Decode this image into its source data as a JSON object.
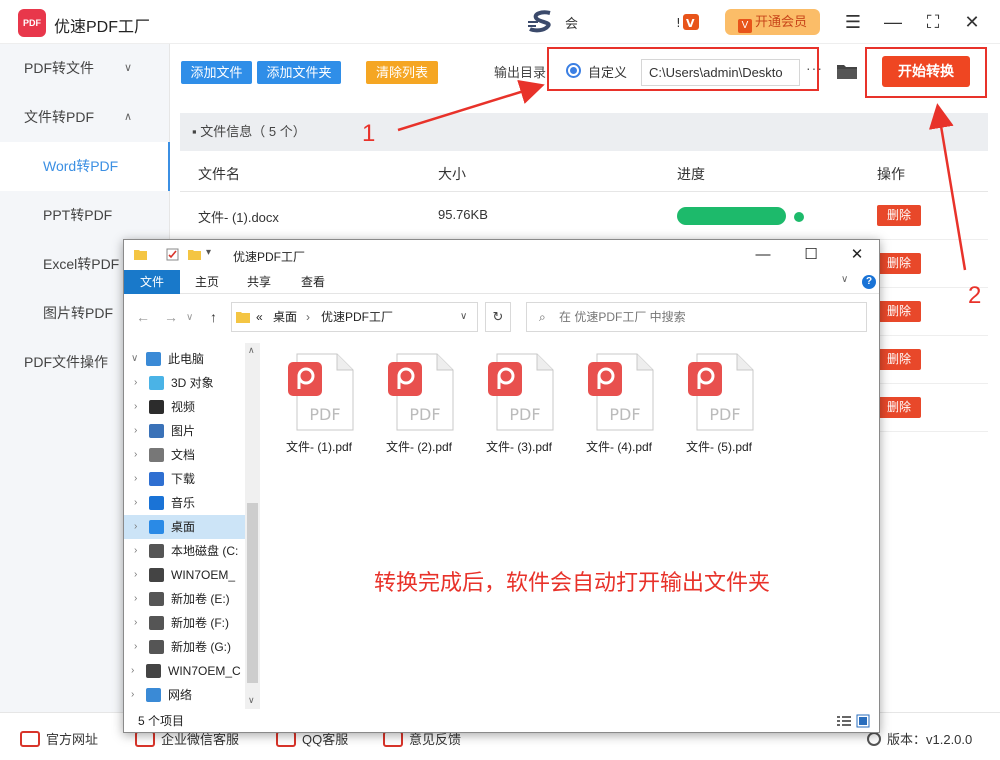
{
  "app": {
    "title": "优速PDF工厂",
    "logo_text": "PDF",
    "s_text": "会",
    "vip_label": "开通会员",
    "vip_icon": "V"
  },
  "sidebar": {
    "items": [
      {
        "label": "PDF转文件",
        "type": "group",
        "chevron": "∨"
      },
      {
        "label": "文件转PDF",
        "type": "group",
        "chevron": "∧"
      },
      {
        "label": "Word转PDF",
        "type": "sub",
        "active": true
      },
      {
        "label": "PPT转PDF",
        "type": "sub"
      },
      {
        "label": "Excel转PDF",
        "type": "sub"
      },
      {
        "label": "图片转PDF",
        "type": "sub"
      },
      {
        "label": "PDF文件操作",
        "type": "group"
      }
    ]
  },
  "toolbar": {
    "add_file": "添加文件",
    "add_folder": "添加文件夹",
    "clear_list": "清除列表",
    "output_dir_label": "输出目录:",
    "custom_label": "自定义",
    "path_value": "C:\\Users\\admin\\Deskto",
    "more": "···",
    "start": "开始转换"
  },
  "file_info": {
    "label": "文件信息（ 5 个）"
  },
  "table": {
    "headers": [
      "文件名",
      "大小",
      "进度",
      "操作"
    ],
    "rows": [
      {
        "name": "文件- (1).docx",
        "size": "95.76KB",
        "progress": 1.0,
        "action": "删除"
      },
      {
        "name": "",
        "size": "",
        "action": "删除"
      },
      {
        "name": "",
        "size": "",
        "action": "删除"
      },
      {
        "name": "",
        "size": "",
        "action": "删除"
      },
      {
        "name": "",
        "size": "",
        "action": "删除"
      }
    ]
  },
  "statusbar": {
    "links": [
      "官方网址",
      "企业微信客服",
      "QQ客服",
      "意见反馈"
    ],
    "version": "版本：v1.2.0.0"
  },
  "annotations": {
    "num1": "1",
    "num2": "2",
    "message": "转换完成后，软件会自动打开输出文件夹"
  },
  "explorer": {
    "title": "优速PDF工厂",
    "ribbon_tabs": [
      "文件",
      "主页",
      "共享",
      "查看"
    ],
    "address": [
      "«",
      "桌面",
      "›",
      "优速PDF工厂"
    ],
    "search_placeholder": "在 优速PDF工厂 中搜索",
    "tree": [
      {
        "label": "此电脑",
        "expanded": true,
        "indent": 0
      },
      {
        "label": "3D 对象",
        "indent": 1
      },
      {
        "label": "视频",
        "indent": 1
      },
      {
        "label": "图片",
        "indent": 1
      },
      {
        "label": "文档",
        "indent": 1
      },
      {
        "label": "下载",
        "indent": 1
      },
      {
        "label": "音乐",
        "indent": 1
      },
      {
        "label": "桌面",
        "indent": 1,
        "selected": true
      },
      {
        "label": "本地磁盘 (C:",
        "indent": 1
      },
      {
        "label": "WIN7OEM_",
        "indent": 1
      },
      {
        "label": "新加卷 (E:)",
        "indent": 1
      },
      {
        "label": "新加卷 (F:)",
        "indent": 1
      },
      {
        "label": "新加卷 (G:)",
        "indent": 1
      },
      {
        "label": "WIN7OEM_C",
        "indent": 0
      },
      {
        "label": "网络",
        "indent": 0
      }
    ],
    "files": [
      "文件- (1).pdf",
      "文件- (2).pdf",
      "文件- (3).pdf",
      "文件- (4).pdf",
      "文件- (5).pdf"
    ],
    "pdf_icon_text": "PDF",
    "status": "5 个项目"
  },
  "colors": {
    "accent_blue": "#3b8fe3",
    "start_red": "#ef4622",
    "progress_green": "#1dba6b",
    "annotation_red": "#e8322a",
    "pdf_red": "#e8504e"
  }
}
